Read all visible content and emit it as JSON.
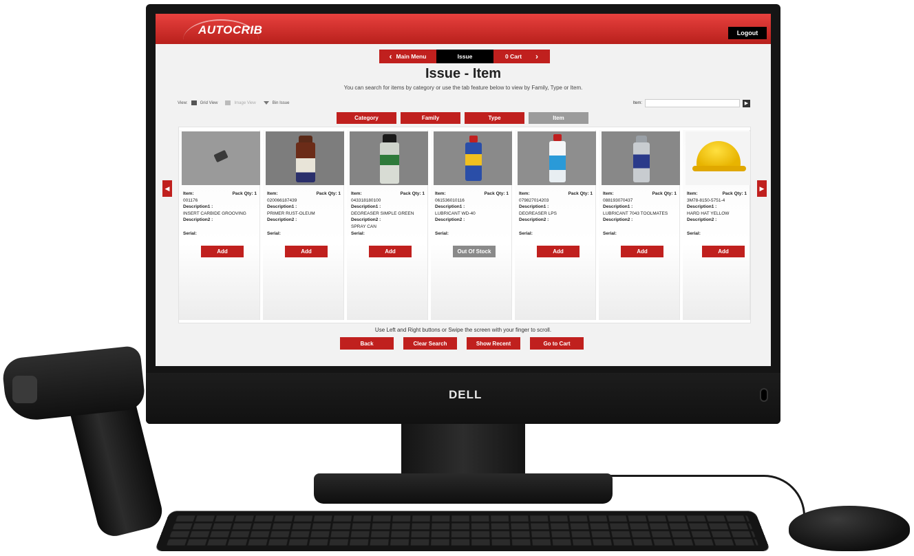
{
  "header": {
    "logo_text": "AUTOCRIB",
    "logout_label": "Logout"
  },
  "nav": {
    "main_menu_label": "Main Menu",
    "issue_label": "Issue",
    "cart_label": "0 Cart"
  },
  "page": {
    "title": "Issue - Item",
    "subtitle": "You can search for items by category or use the tab feature below to view by Family, Type or Item."
  },
  "view_bar": {
    "view_label": "View:",
    "grid_view_label": "Grid View",
    "image_view_label": "Image View",
    "bin_issue_label": "Bin Issue"
  },
  "search": {
    "label": "Item:",
    "value": ""
  },
  "filter_tabs": [
    "Category",
    "Family",
    "Type",
    "Item"
  ],
  "items": [
    {
      "item_label": "Item:",
      "pack_qty": "Pack Qty: 1",
      "item_number": "001176",
      "desc1_label": "Description1 :",
      "desc1": "INSERT  CARBIDE  GROOVING",
      "desc2_label": "Description2 :",
      "desc2": "",
      "serial_label": "Serial:",
      "action": "Add"
    },
    {
      "item_label": "Item:",
      "pack_qty": "Pack Qty: 1",
      "item_number": "020066187439",
      "desc1_label": "Description1 :",
      "desc1": "PRIMER  RUST-OLEUM",
      "desc2_label": "Description2 :",
      "desc2": "",
      "serial_label": "Serial:",
      "action": "Add"
    },
    {
      "item_label": "Item:",
      "pack_qty": "Pack Qty: 1",
      "item_number": "043318180100",
      "desc1_label": "Description1 :",
      "desc1": "DEGREASER  SIMPLE  GREEN",
      "desc2_label": "Description2 :",
      "desc2": "SPRAY  CAN",
      "serial_label": "Serial:",
      "action": "Add"
    },
    {
      "item_label": "Item:",
      "pack_qty": "Pack Qty: 1",
      "item_number": "061536010116",
      "desc1_label": "Description1 :",
      "desc1": "LUBRICANT  WD-40",
      "desc2_label": "Description2 :",
      "desc2": "",
      "serial_label": "Serial:",
      "action": "Out Of Stock"
    },
    {
      "item_label": "Item:",
      "pack_qty": "Pack Qty: 1",
      "item_number": "079827014203",
      "desc1_label": "Description1 :",
      "desc1": "DEGREASER  LPS",
      "desc2_label": "Description2 :",
      "desc2": "",
      "serial_label": "Serial:",
      "action": "Add"
    },
    {
      "item_label": "Item:",
      "pack_qty": "Pack Qty: 1",
      "item_number": "088193070437",
      "desc1_label": "Description1 :",
      "desc1": "LUBRICANT  7043  TOOLMATES",
      "desc2_label": "Description2 :",
      "desc2": "",
      "serial_label": "Serial:",
      "action": "Add"
    },
    {
      "item_label": "Item:",
      "pack_qty": "Pack Qty: 1",
      "item_number": "3M78-8150-5751-4",
      "desc1_label": "Description1 :",
      "desc1": "HARD HAT YELLOW",
      "desc2_label": "Description2 :",
      "desc2": "",
      "serial_label": "Serial:",
      "action": "Add"
    }
  ],
  "scroll_hint": "Use Left and Right buttons or Swipe the screen with your finger to scroll.",
  "bottom_buttons": {
    "back": "Back",
    "clear_search": "Clear Search",
    "show_recent": "Show Recent",
    "go_to_cart": "Go to Cart"
  },
  "hardware": {
    "monitor_brand": "DELL"
  },
  "colors": {
    "brand_red": "#c0201e",
    "header_red": "#d8302c",
    "active_tab_gray": "#9b9b9b",
    "dark": "#000000"
  },
  "icons": [
    "grid-icon",
    "image-icon",
    "filter-icon",
    "search-icon",
    "chevron-left-icon",
    "chevron-right-icon"
  ]
}
